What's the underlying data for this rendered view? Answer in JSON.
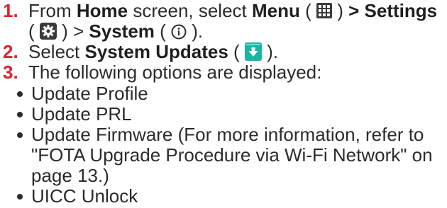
{
  "steps": [
    {
      "number": "1.",
      "parts": {
        "t1": "From ",
        "home": "Home",
        "t2": " screen, select ",
        "menu": "Menu",
        "t3": " ( ",
        "t4": " ) ",
        "settings": "> Settings",
        "t5": "( ",
        "t6": " ) > ",
        "system": "System",
        "t7": " ( ",
        "t8": " )."
      },
      "icons": [
        "menu-grid-icon",
        "settings-gear-icon",
        "info-circle-icon"
      ]
    },
    {
      "number": "2.",
      "parts": {
        "t1": "Select ",
        "system_updates": "System Updates",
        "t2": " ( ",
        "t3": " )."
      },
      "icons": [
        "system-update-download-icon"
      ]
    },
    {
      "number": "3.",
      "text": "The following options are displayed:",
      "options": [
        "Update Profile",
        "Update PRL",
        "Update Firmware (For more information, refer to \"FOTA Upgrade Procedure via Wi-Fi Network\" on page 13.)",
        "UICC Unlock"
      ]
    }
  ],
  "colors": {
    "step_number": "#d9262e",
    "body_text": "#2b2b2b",
    "icon_dark": "#3a3a3a",
    "update_icon": "#1ab6a2"
  }
}
